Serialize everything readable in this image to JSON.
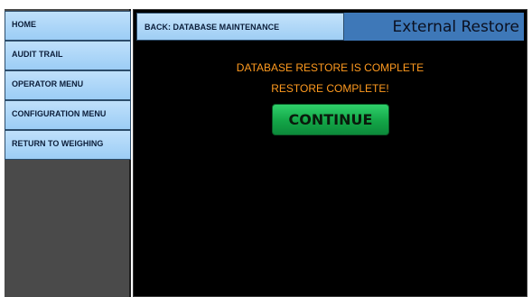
{
  "sidebar": {
    "items": [
      {
        "label": "HOME"
      },
      {
        "label": "AUDIT TRAIL"
      },
      {
        "label": "OPERATOR MENU"
      },
      {
        "label": "CONFIGURATION MENU"
      },
      {
        "label": "RETURN TO WEIGHING"
      }
    ]
  },
  "header": {
    "back_label": "BACK: DATABASE MAINTENANCE",
    "title": "External Restore"
  },
  "main": {
    "message_line1": "DATABASE RESTORE IS COMPLETE",
    "message_line2": "RESTORE COMPLETE!",
    "continue_label": "CONTINUE"
  },
  "colors": {
    "message": "#ff9a1f",
    "continue_button": "#13a547",
    "nav_button": "#9ccdf5",
    "title_bar": "#3e78b8"
  }
}
